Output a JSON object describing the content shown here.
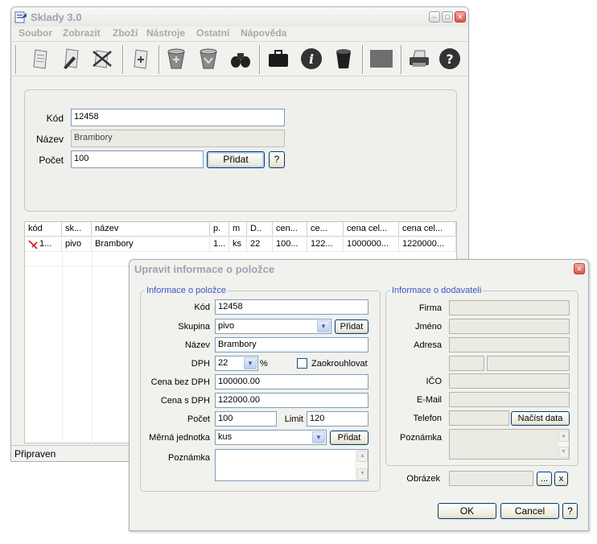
{
  "main_window": {
    "title": "Sklady 3.0",
    "menu": [
      "Soubor",
      "Zobrazit",
      "Zboží",
      "Nástroje",
      "Ostatní",
      "Nápověda"
    ],
    "toolbar_icons": [
      "document-icon",
      "edit-icon",
      "delete-icon",
      "add-document-icon",
      "bucket-icon",
      "bucket-down-icon",
      "binoculars-icon",
      "briefcase-icon",
      "info-icon",
      "trash-can-icon",
      "gray-square-icon",
      "printer-icon",
      "help-icon"
    ],
    "form": {
      "kod_label": "Kód",
      "kod_value": "12458",
      "nazev_label": "Název",
      "nazev_value": "Brambory",
      "pocet_label": "Počet",
      "pocet_value": "100",
      "pridat_label": "Přidat",
      "help_label": "?"
    },
    "table": {
      "columns": [
        "kód",
        "sk...",
        "název",
        "p.",
        "m",
        "D..",
        "cen...",
        "ce...",
        "cena cel...",
        "cena cel..."
      ],
      "rows": [
        [
          "1...",
          "pivo",
          "Brambory",
          "1...",
          "ks",
          "22",
          "100...",
          "122...",
          "1000000...",
          "1220000..."
        ]
      ]
    },
    "status": "Připraven"
  },
  "dialog": {
    "title": "Upravit informace o položce",
    "item_group": "Informace o položce",
    "supplier_group": "Informace o dodavateli",
    "fields": {
      "kod_label": "Kód",
      "kod_value": "12458",
      "skupina_label": "Skupina",
      "skupina_value": "pivo",
      "skupina_add": "Přidat",
      "nazev_label": "Název",
      "nazev_value": "Brambory",
      "dph_label": "DPH",
      "dph_value": "22",
      "dph_unit": "%",
      "round_label": "Zaokrouhlovat",
      "cena_bez_label": "Cena bez DPH",
      "cena_bez_value": "100000.00",
      "cena_s_label": "Cena s DPH",
      "cena_s_value": "122000.00",
      "pocet_label": "Počet",
      "pocet_value": "100",
      "limit_label": "Limit",
      "limit_value": "120",
      "jednotka_label": "Měrná jednotka",
      "jednotka_value": "kus",
      "jednotka_add": "Přidat",
      "poznamka_label": "Poznámka"
    },
    "supplier": {
      "firma_label": "Firma",
      "jmeno_label": "Jméno",
      "adresa_label": "Adresa",
      "ico_label": "IČO",
      "email_label": "E-Mail",
      "telefon_label": "Telefon",
      "nacist_label": "Načíst data",
      "poznamka_label": "Poznámka"
    },
    "obrazek_label": "Obrázek",
    "browse_label": "...",
    "clear_label": "x",
    "ok_label": "OK",
    "cancel_label": "Cancel",
    "help_label": "?"
  }
}
